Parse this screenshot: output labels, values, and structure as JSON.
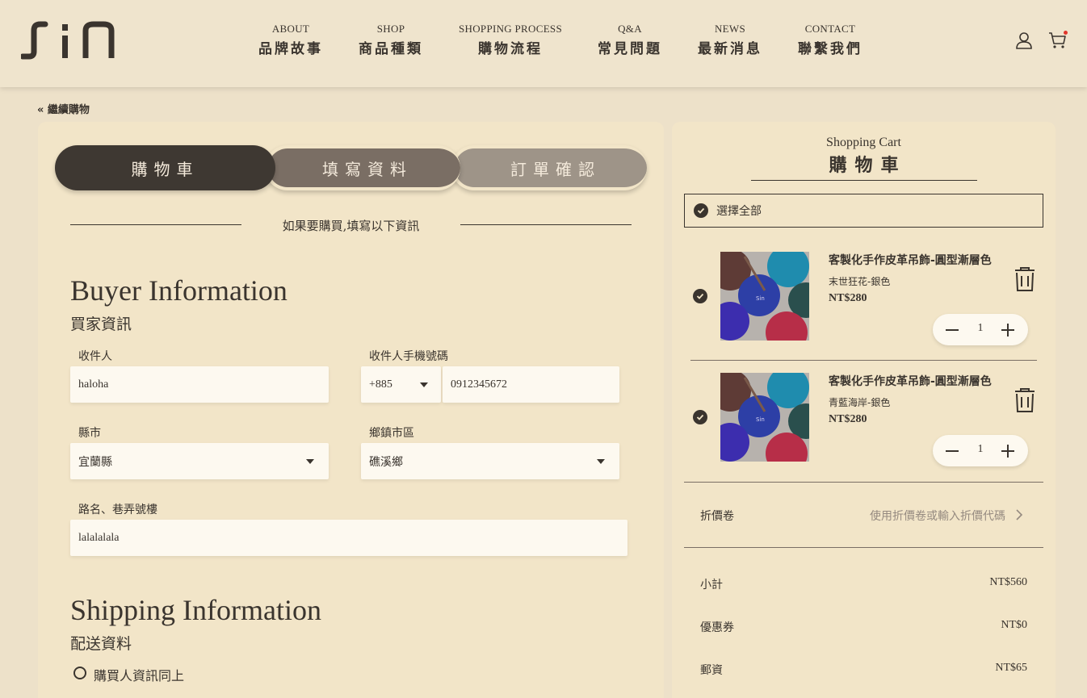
{
  "header": {
    "nav": [
      {
        "en": "ABOUT",
        "zh": "品牌故事"
      },
      {
        "en": "SHOP",
        "zh": "商品種類"
      },
      {
        "en": "SHOPPING PROCESS",
        "zh": "購物流程"
      },
      {
        "en": "Q&A",
        "zh": "常見問題"
      },
      {
        "en": "NEWS",
        "zh": "最新消息"
      },
      {
        "en": "CONTACT",
        "zh": "聯繫我們"
      }
    ],
    "icons": [
      "user-icon",
      "cart-icon"
    ]
  },
  "back_link": "« 繼續購物",
  "steps": [
    "購物車",
    "填寫資料",
    "訂單確認"
  ],
  "divider_text": "如果要購買,填寫以下資訊",
  "buyer": {
    "title_en": "Buyer Information",
    "title_zh": "買家資訊",
    "recipient_label": "收件人",
    "recipient_value": "haloha",
    "phone_label": "收件人手機號碼",
    "phone_code": "+885",
    "phone_value": "0912345672",
    "county_label": "縣市",
    "county_value": "宜蘭縣",
    "district_label": "鄉鎮市區",
    "district_value": "礁溪鄉",
    "address_label": "路名、巷弄號樓",
    "address_value": "lalalalala"
  },
  "shipping": {
    "title_en": "Shipping Information",
    "title_zh": "配送資料",
    "same_as_buyer": "購買人資訊同上"
  },
  "cart": {
    "title_en": "Shopping Cart",
    "title_zh": "購物車",
    "select_all": "選擇全部",
    "items": [
      {
        "name": "客製化手作皮革吊飾-圓型漸層色",
        "variant": "末世狂花-銀色",
        "price": "NT$280",
        "qty": "1"
      },
      {
        "name": "客製化手作皮革吊飾-圓型漸層色",
        "variant": "青藍海岸-銀色",
        "price": "NT$280",
        "qty": "1"
      }
    ],
    "coupon_label": "折價卷",
    "coupon_hint": "使用折價卷或輸入折價代碼",
    "subtotal_label": "小計",
    "subtotal_value": "NT$560",
    "discount_label": "優惠券",
    "discount_value": "NT$0",
    "shipping_label": "郵資",
    "shipping_value": "NT$65"
  },
  "colors": {
    "background": "#ede1c9",
    "panel": "#f2e5c8",
    "dark": "#3a342e",
    "cart_dot": "#e0352b"
  }
}
